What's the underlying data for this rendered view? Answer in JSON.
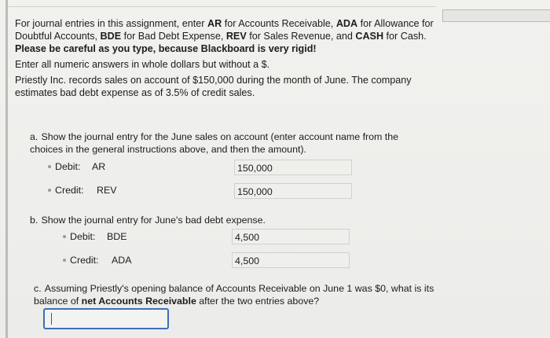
{
  "instructions": {
    "line1_pre": "For journal entries in this assignment, enter ",
    "ar": "AR",
    "line1_mid1": " for Accounts Receivable, ",
    "ada": "ADA",
    "line1_mid2": " for Allowance for Doubtful Accounts, ",
    "bde": "BDE",
    "line1_mid3": " for Bad Debt Expense, ",
    "rev": "REV",
    "line1_mid4": " for Sales Revenue, and ",
    "cash": "CASH",
    "line1_mid5": " for Cash. ",
    "warning": "Please be careful as you type, because Blackboard is very rigid!",
    "numeric": "Enter all numeric answers in whole dollars but without a $.",
    "scenario": "Priestly Inc. records sales on account of $150,000 during the month of June. The company estimates bad debt expense as of 3.5% of credit sales."
  },
  "question_a": {
    "letter": "a.",
    "text": "Show the journal entry for the June sales on account (enter account name from the choices in the general instructions above, and then the amount).",
    "debit_label": "Debit:",
    "debit_account": "AR",
    "debit_amount": "150,000",
    "credit_label": "Credit:",
    "credit_account": "REV",
    "credit_amount": "150,000"
  },
  "question_b": {
    "letter": "b.",
    "text": "Show the journal entry for June's bad debt expense.",
    "debit_label": "Debit:",
    "debit_account": "BDE",
    "debit_amount": "4,500",
    "credit_label": "Credit:",
    "credit_account": "ADA",
    "credit_amount": "4,500"
  },
  "question_c": {
    "letter": "c.",
    "text_pre": "Assuming Priestly's opening balance of Accounts Receivable on June 1 was $0, what is its balance of ",
    "text_bold": "net Accounts Receivable",
    "text_post": " after the two entries above?",
    "answer_value": ""
  }
}
